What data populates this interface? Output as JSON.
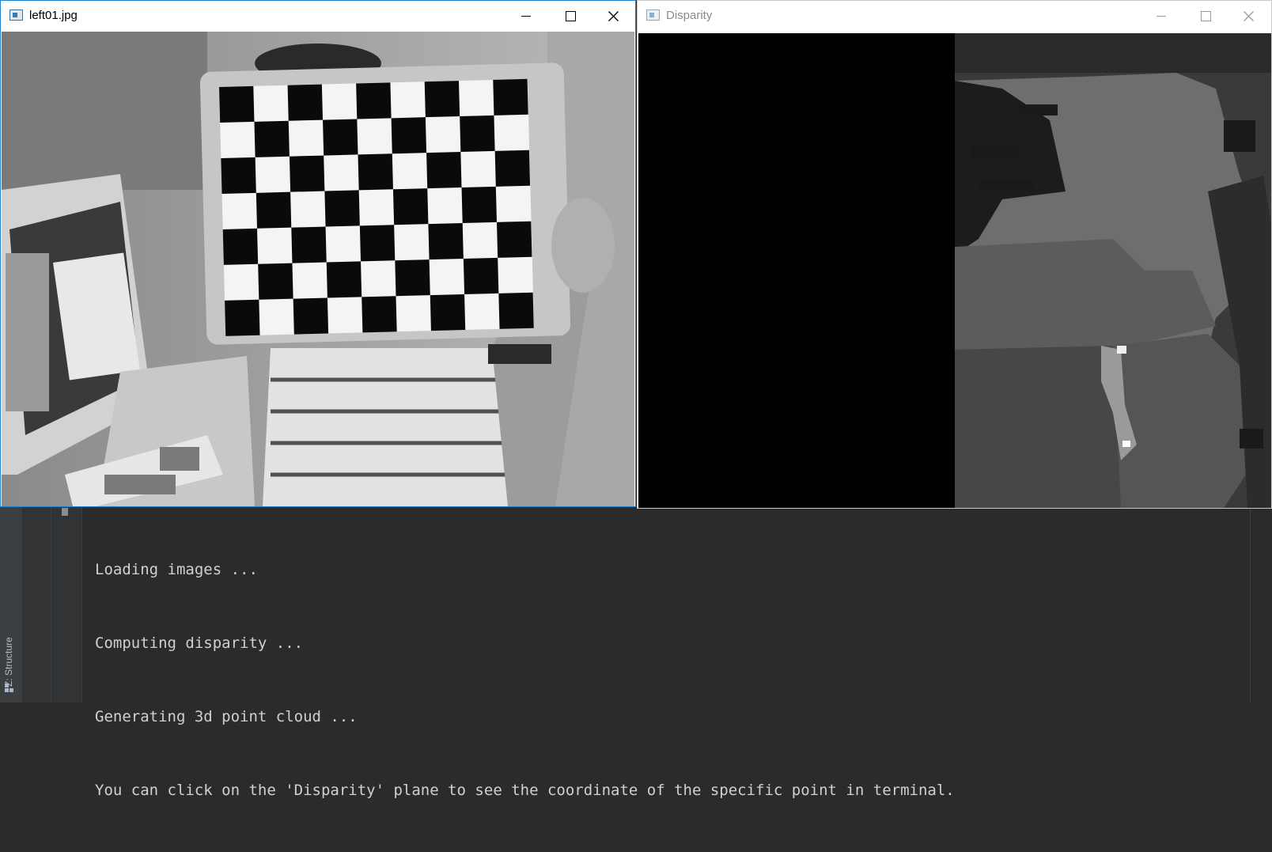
{
  "windows": {
    "left": {
      "title": "left01.jpg"
    },
    "right": {
      "title": "Disparity"
    }
  },
  "ide": {
    "structure_tab": "Z: Structure",
    "console_lines": [
      "Loading images ...",
      "Computing disparity ...",
      "Generating 3d point cloud ...",
      "You can click on the 'Disparity' plane to see the coordinate of the specific point in terminal."
    ]
  },
  "colors": {
    "active_border": "#1883d7",
    "ide_bg": "#2b2b2b",
    "console_text": "#d0d0d0"
  }
}
